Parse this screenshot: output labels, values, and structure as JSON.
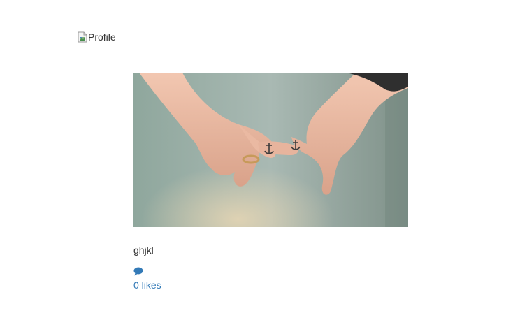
{
  "profile": {
    "image_alt": "Profile"
  },
  "post": {
    "caption": "ghjkl",
    "likes_text": "0 likes"
  },
  "icons": {
    "comment": "comment-icon",
    "broken_image": "broken-image-icon"
  },
  "colors": {
    "link": "#337ab7",
    "text": "#333333"
  }
}
